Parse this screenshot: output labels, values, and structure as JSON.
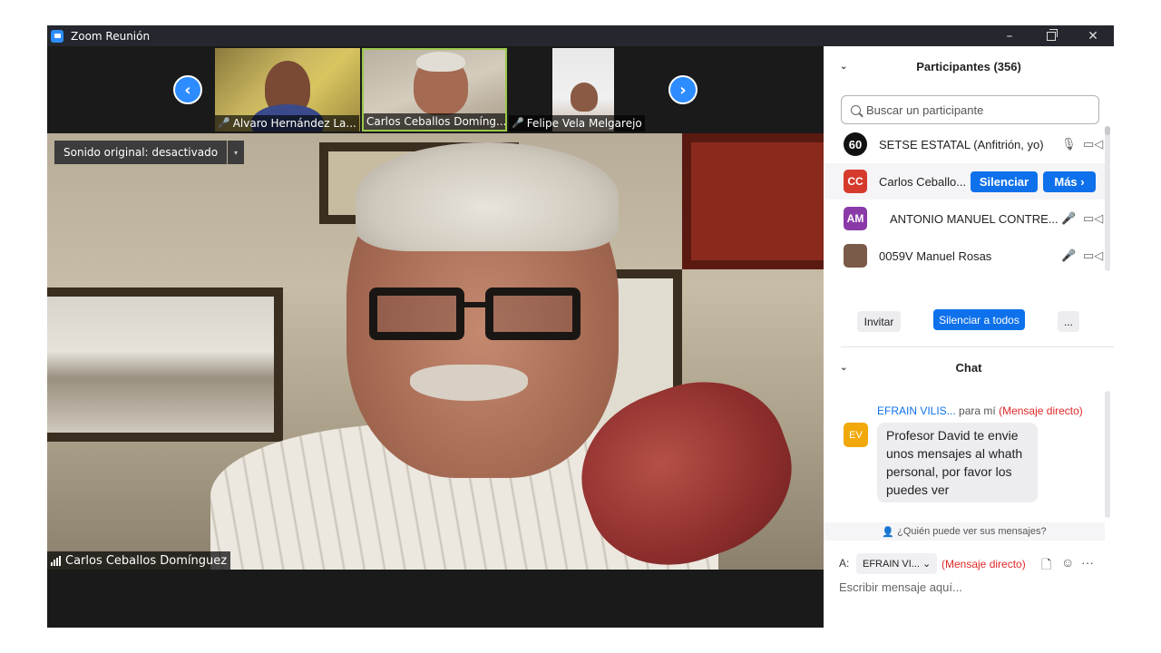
{
  "window": {
    "title": "Zoom Reunión",
    "minimize": "–",
    "close": "✕"
  },
  "strip": {
    "prev": "‹",
    "next": "›",
    "thumbnails": [
      {
        "name": "Alvaro Hernández La...",
        "muted": true
      },
      {
        "name": "Carlos Ceballos Domíng...",
        "muted": false
      },
      {
        "name": "Felipe Vela Melgarejo",
        "muted": true
      }
    ]
  },
  "main_video": {
    "sound_button": "Sonido original: desactivado",
    "dropdown": "▾",
    "speaker_name": "Carlos Ceballos Domínguez"
  },
  "participants": {
    "header": "Participantes (356)",
    "search_placeholder": "Buscar un participante",
    "list": [
      {
        "initials": "60",
        "name": "SETSE ESTATAL (Anfitrión, yo)",
        "avatar_color": "#111111"
      },
      {
        "initials": "CC",
        "name": "Carlos Ceballo...",
        "avatar_color": "#d63a2c"
      },
      {
        "initials": "AM",
        "name": "ANTONIO MANUEL CONTRE...",
        "avatar_color": "#8a3aa8"
      },
      {
        "initials": "",
        "name": "0059V Manuel Rosas",
        "avatar_color": "#7a5a48"
      }
    ],
    "mute_button": "Silenciar",
    "more_button": "Más ›",
    "invite": "Invitar",
    "mute_all": "Silenciar a todos",
    "more_options": "..."
  },
  "chat": {
    "header": "Chat",
    "message": {
      "from": "EFRAIN VILIS...",
      "to": "para mí",
      "type": "(Mensaje directo)",
      "avatar": "EV",
      "text": "Profesor David te envie unos mensajes al whath personal, por favor los puedes ver"
    },
    "who_can_see": "¿Quién puede ver sus mensajes?",
    "to_label": "A:",
    "recipient": "EFRAIN VI... ⌄",
    "recipient_type": "(Mensaje directo)",
    "input_placeholder": "Escribir mensaje aquí...",
    "more": "···"
  },
  "colors": {
    "accent": "#0e71eb",
    "muted_red": "#e02828",
    "active_speaker": "#9bc84a"
  }
}
